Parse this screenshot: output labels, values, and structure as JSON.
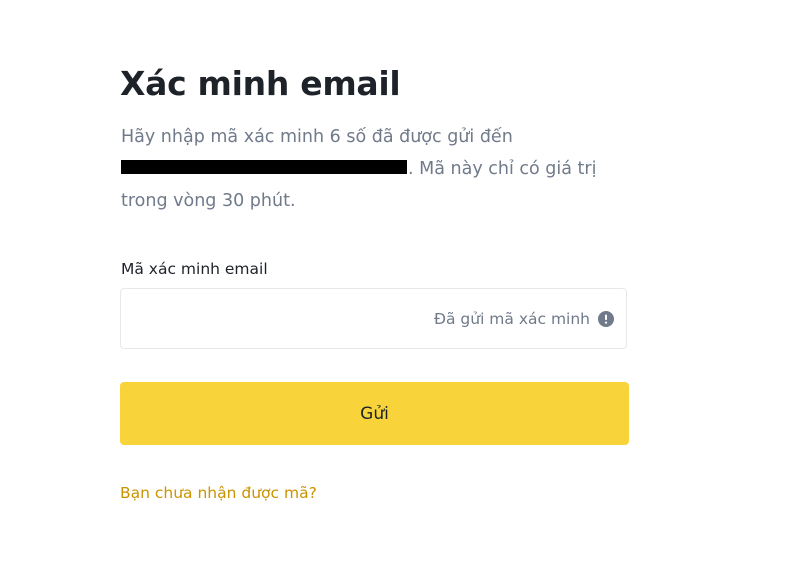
{
  "header": {
    "title": "Xác minh email"
  },
  "description": {
    "text_before": "Hãy nhập mã xác minh 6 số đã được gửi đến",
    "text_after": ". Mã này chỉ có giá trị trong vòng 30 phút."
  },
  "form": {
    "field_label": "Mã xác minh email",
    "input_value": "",
    "input_placeholder": "",
    "sent_hint": "Đã gửi mã xác minh",
    "hint_icon": "info-icon",
    "submit_label": "Gửi",
    "resend_link": "Bạn chưa nhận được mã?"
  },
  "colors": {
    "primary_button": "#f8d33a",
    "link": "#c99400",
    "title": "#1e2329",
    "muted_text": "#707a8a",
    "border": "#e6e8ea"
  }
}
